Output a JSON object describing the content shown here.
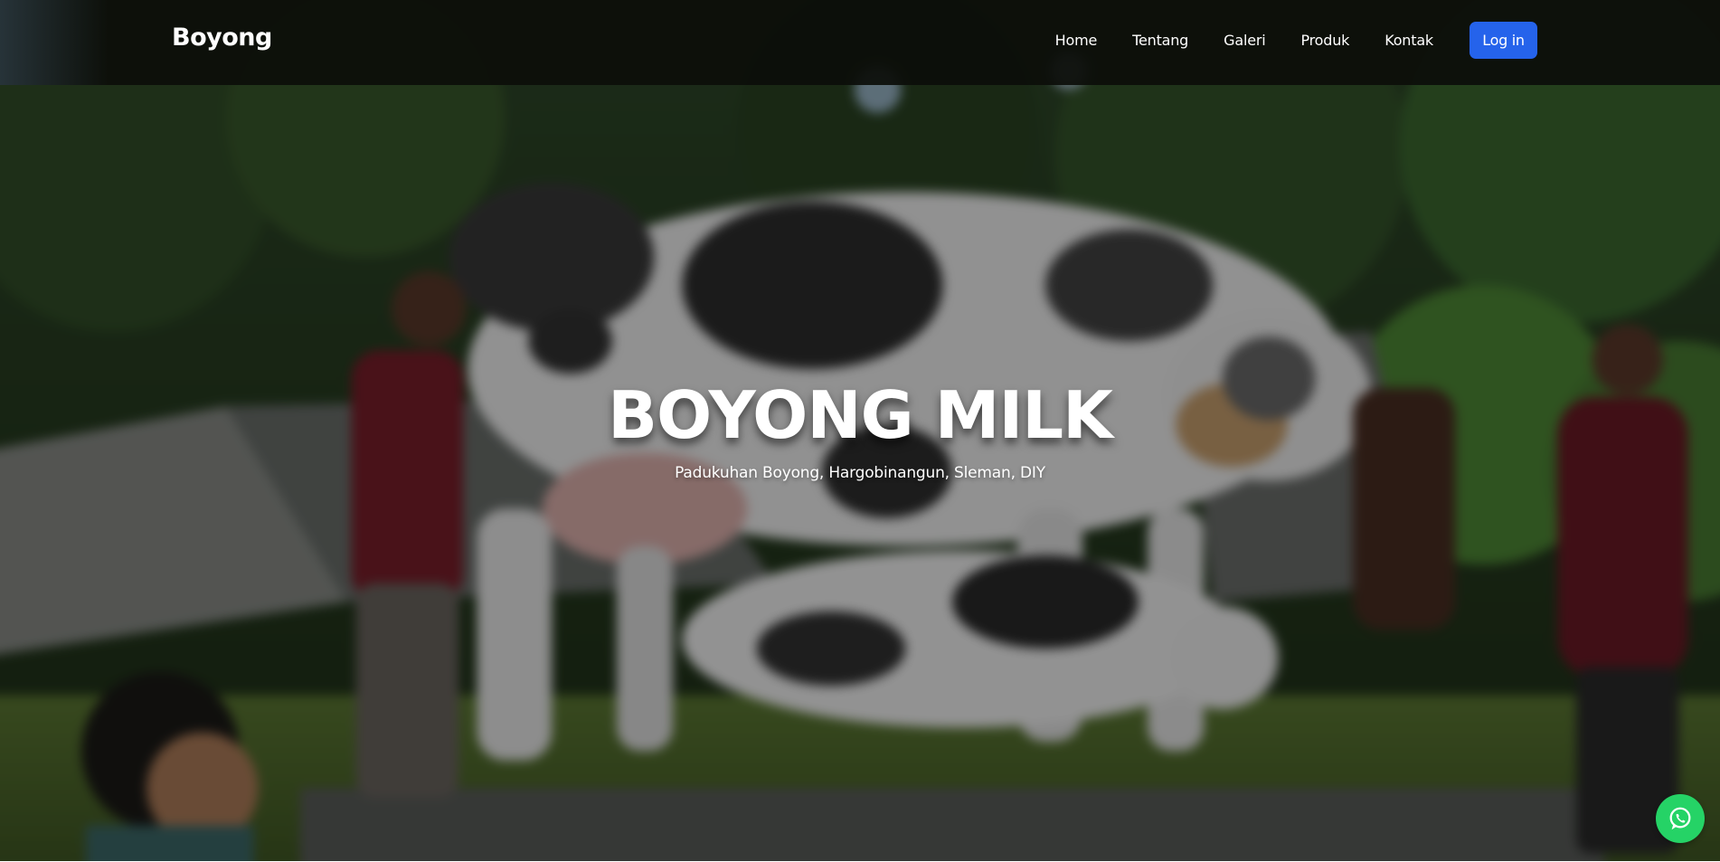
{
  "navbar": {
    "brand": "Boyong",
    "links": [
      "Home",
      "Tentang",
      "Galeri",
      "Produk",
      "Kontak"
    ],
    "login_label": "Log in"
  },
  "hero": {
    "title": "BOYONG MILK",
    "subtitle": "Padukuhan Boyong, Hargobinangun, Sleman, DIY",
    "background_image": "blurred-cow-statue-photo"
  },
  "floating": {
    "whatsapp_icon": "whatsapp-icon"
  },
  "colors": {
    "primary": "#2563eb",
    "whatsapp": "#25d366",
    "navbar": "#0c0e0a"
  }
}
